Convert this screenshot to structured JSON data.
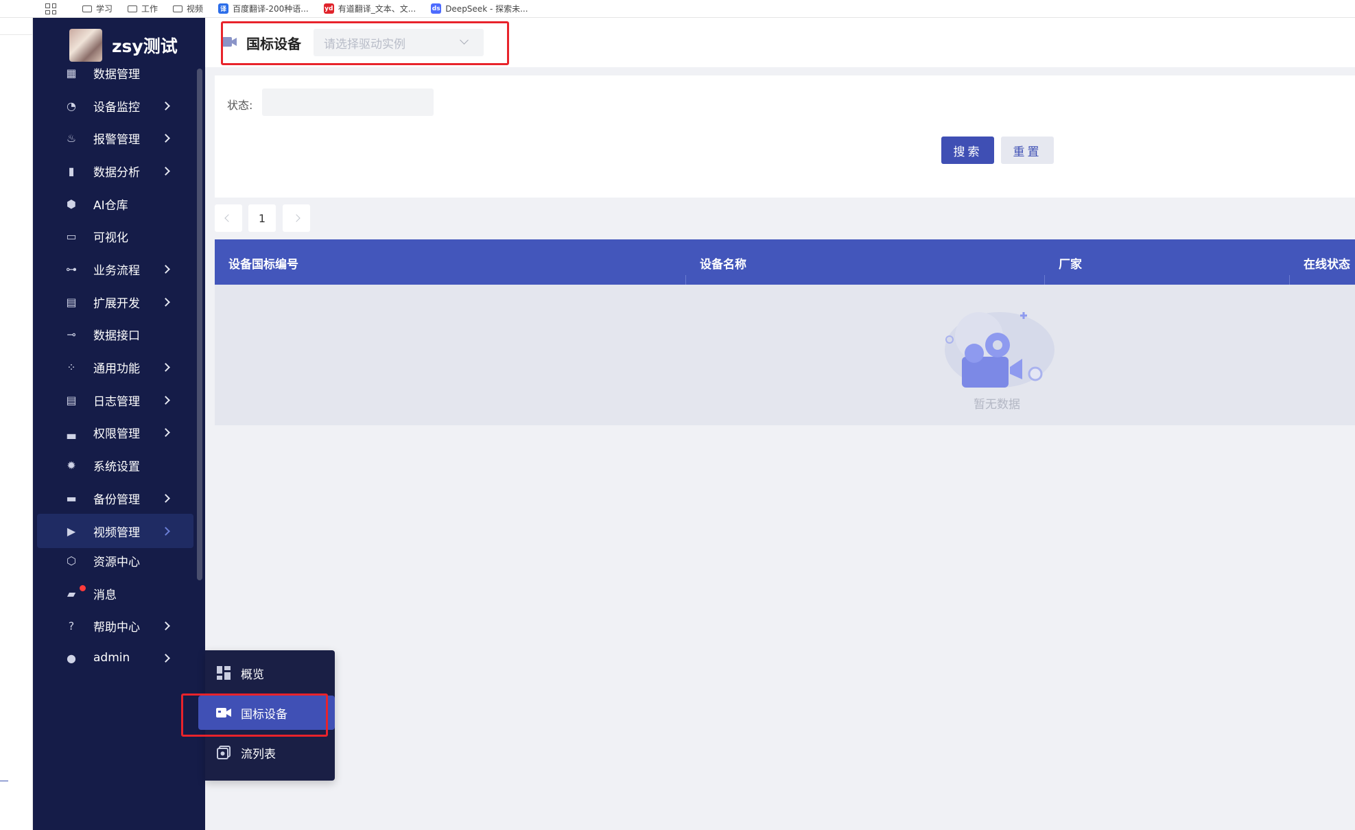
{
  "bookmarks": {
    "items": [
      {
        "label": "学习",
        "type": "folder"
      },
      {
        "label": "工作",
        "type": "folder"
      },
      {
        "label": "视频",
        "type": "folder"
      },
      {
        "label": "百度翻译-200种语...",
        "type": "favicon",
        "badge": "译",
        "color": "#2b6de9"
      },
      {
        "label": "有道翻译_文本、文...",
        "type": "favicon",
        "badge": "yd",
        "color": "#e0242b"
      },
      {
        "label": "DeepSeek - 探索未...",
        "type": "favicon",
        "badge": "ds",
        "color": "#4d6bfe"
      }
    ]
  },
  "sidebar": {
    "brand": "zsy测试",
    "items": [
      {
        "label": "数据管理",
        "icon": "data-icon",
        "chevron": false
      },
      {
        "label": "设备监控",
        "icon": "monitor-icon",
        "chevron": true
      },
      {
        "label": "报警管理",
        "icon": "alarm-icon",
        "chevron": true
      },
      {
        "label": "数据分析",
        "icon": "bar-chart-icon",
        "chevron": true
      },
      {
        "label": "AI仓库",
        "icon": "ai-icon",
        "chevron": false
      },
      {
        "label": "可视化",
        "icon": "screen-icon",
        "chevron": false
      },
      {
        "label": "业务流程",
        "icon": "flow-icon",
        "chevron": true
      },
      {
        "label": "扩展开发",
        "icon": "code-icon",
        "chevron": true
      },
      {
        "label": "数据接口",
        "icon": "plug-icon",
        "chevron": false
      },
      {
        "label": "通用功能",
        "icon": "grid-icon",
        "chevron": true
      },
      {
        "label": "日志管理",
        "icon": "log-icon",
        "chevron": true
      },
      {
        "label": "权限管理",
        "icon": "lock-icon",
        "chevron": true
      },
      {
        "label": "系统设置",
        "icon": "gear-icon",
        "chevron": false
      },
      {
        "label": "备份管理",
        "icon": "backup-icon",
        "chevron": true
      },
      {
        "label": "视频管理",
        "icon": "video-icon",
        "chevron": true,
        "active": true
      },
      {
        "label": "资源中心",
        "icon": "cube-icon",
        "chevron": false
      },
      {
        "label": "消息",
        "icon": "message-icon",
        "chevron": false,
        "badge": true
      },
      {
        "label": "帮助中心",
        "icon": "help-icon",
        "chevron": true
      },
      {
        "label": "admin",
        "icon": "user-icon",
        "chevron": true
      }
    ]
  },
  "submenu": {
    "items": [
      {
        "label": "概览",
        "icon": "dashboard-icon"
      },
      {
        "label": "国标设备",
        "icon": "camera-icon",
        "active": true
      },
      {
        "label": "流列表",
        "icon": "stream-icon"
      }
    ]
  },
  "header": {
    "title": "国标设备",
    "select_placeholder": "请选择驱动实例"
  },
  "filter": {
    "status_label": "状态:",
    "search_label": "搜索",
    "reset_label": "重置"
  },
  "pagination": {
    "current": "1"
  },
  "table": {
    "columns": [
      "设备国标编号",
      "设备名称",
      "厂家",
      "在线状态"
    ],
    "empty_text": "暂无数据"
  },
  "colors": {
    "sidebar_bg": "#151c48",
    "accent": "#4356bb",
    "highlight_box": "#e8232b"
  }
}
